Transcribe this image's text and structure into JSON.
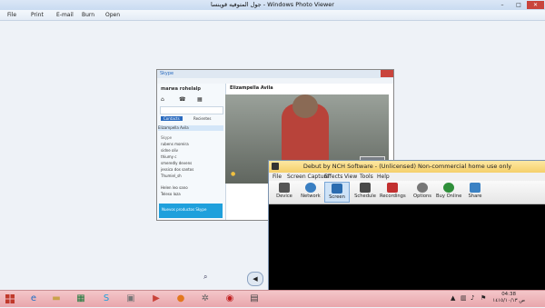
{
  "viewer": {
    "title": "جول المتوفيه قوينسا - Windows Photo Viewer",
    "menu": [
      "File",
      "Print",
      "E-mail",
      "Burn",
      "Open"
    ],
    "window_controls": [
      "–",
      "□",
      "✕"
    ]
  },
  "skype": {
    "brand": "Skype",
    "user": "marwa rohelalp",
    "contact_header": "Elizampella Avila",
    "tabs": [
      "Contacts",
      "Recientes"
    ],
    "list_label": "Skype",
    "contacts": [
      "Elizampella Avila",
      "rubens moreira",
      "sidne oliv",
      "thiumy c",
      "smeredly devens",
      "jessica dos santos",
      "Thumiel_sh",
      "Helen leo sano",
      "Teleso loza"
    ],
    "promo_text": "Nuevos productos Skype"
  },
  "nch": {
    "title": "Debut by NCH Software - (Unlicensed) Non-commercial home use only",
    "menu": [
      "File",
      "Screen Capture",
      "Effects",
      "View",
      "Tools",
      "Help"
    ],
    "toolbar": [
      {
        "label": "Device",
        "icon": "device-icon",
        "color": "#555555"
      },
      {
        "label": "Network",
        "icon": "network-icon",
        "color": "#3a7fc2"
      },
      {
        "label": "Screen",
        "icon": "screen-icon",
        "color": "#2b6cb0"
      },
      {
        "label": "Schedule",
        "icon": "schedule-icon",
        "color": "#4a4a4a"
      },
      {
        "label": "Recordings",
        "icon": "recordings-icon",
        "color": "#c23030"
      },
      {
        "label": "Options",
        "icon": "options-icon",
        "color": "#777777"
      },
      {
        "label": "Buy Online",
        "icon": "buy-online-icon",
        "color": "#2f8f3a"
      },
      {
        "label": "Share",
        "icon": "share-icon",
        "color": "#3b82c4"
      }
    ]
  },
  "taskbar": {
    "clock_time": "04:38",
    "clock_date": "ص ١٤١٥/١٠/١٣",
    "accent": "#e8a6ac"
  }
}
